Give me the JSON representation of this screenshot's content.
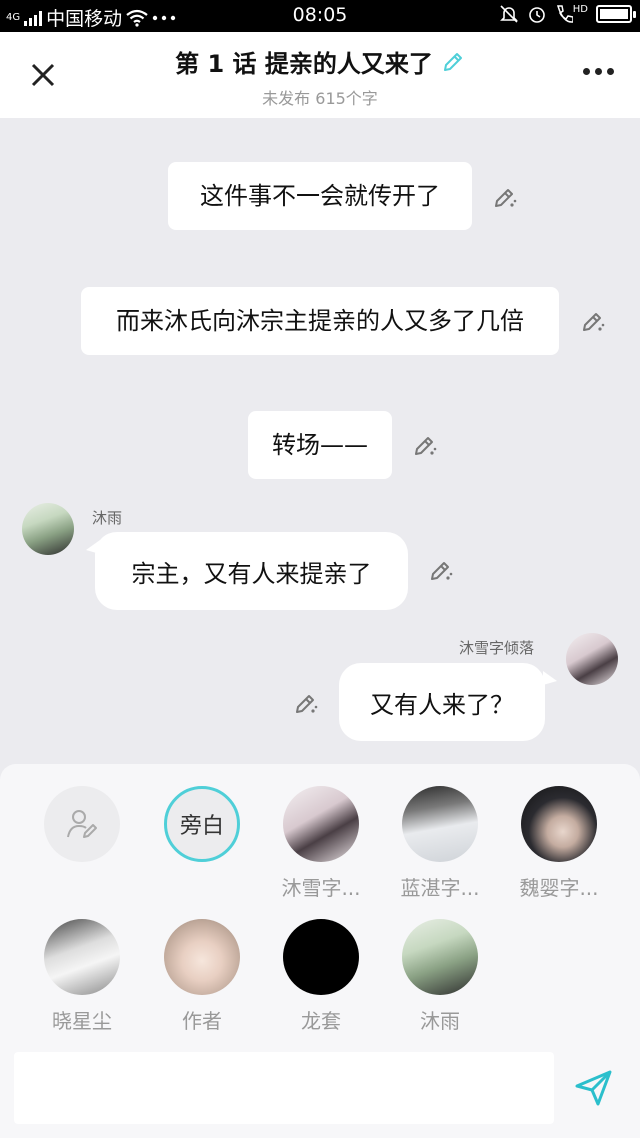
{
  "status_bar": {
    "network": "4G",
    "carrier": "中国移动",
    "time": "08:05",
    "hd": "HD"
  },
  "header": {
    "title": "第 1 话 提亲的人又来了",
    "subtitle": "未发布 615个字"
  },
  "messages": [
    {
      "type": "narration",
      "text": "这件事不一会就传开了"
    },
    {
      "type": "narration",
      "text": "而来沐氏向沐宗主提亲的人又多了几倍"
    },
    {
      "type": "narration",
      "text": "转场——"
    },
    {
      "type": "left",
      "speaker": "沐雨",
      "text": "宗主，又有人来提亲了"
    },
    {
      "type": "right",
      "speaker": "沐雪字倾落",
      "text": "又有人来了？"
    }
  ],
  "characters": [
    {
      "name": "",
      "kind": "add-character"
    },
    {
      "name": "",
      "kind": "narrator",
      "label": "旁白"
    },
    {
      "name": "沐雪字...",
      "kind": "photo"
    },
    {
      "name": "蓝湛字...",
      "kind": "photo"
    },
    {
      "name": "魏婴字...",
      "kind": "photo"
    },
    {
      "name": "晓星尘",
      "kind": "photo"
    },
    {
      "name": "作者",
      "kind": "photo"
    },
    {
      "name": "龙套",
      "kind": "solid"
    },
    {
      "name": "沐雨",
      "kind": "photo"
    }
  ],
  "colors": {
    "accent": "#4fcfd8",
    "background": "#ebebef"
  },
  "icons": [
    "close-icon",
    "pencil-icon",
    "more-icon",
    "edit-icon",
    "add-person-icon",
    "send-icon"
  ]
}
